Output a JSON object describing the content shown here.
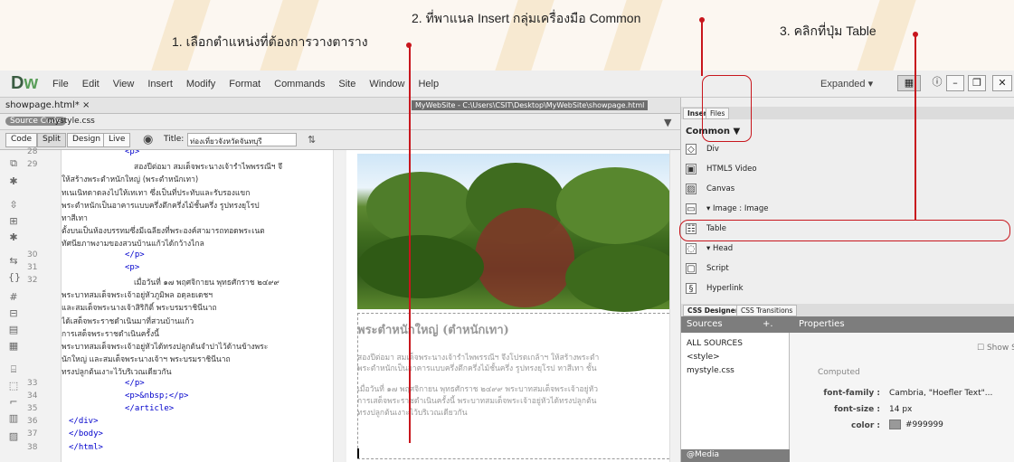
{
  "callouts": {
    "step1": "1. เลือกตำแหน่งที่ต้องการวางตาราง",
    "step2": "2. ที่พาแนล Insert กลุ่มเครื่องมือ Common",
    "step3": "3. คลิกที่ปุ่ม Table"
  },
  "app": {
    "logo_d": "D",
    "logo_w": "w",
    "menu": [
      "File",
      "Edit",
      "View",
      "Insert",
      "Modify",
      "Format",
      "Commands",
      "Site",
      "Window",
      "Help"
    ],
    "workspace": "Expanded",
    "workspace_arrow": "▾"
  },
  "document": {
    "tab": "showpage.html*",
    "tab_close": "×",
    "path": "MyWebSite - C:\\Users\\CSIT\\Desktop\\MyWebSite\\showpage.html",
    "source_code": "Source Code",
    "css_file": "mystyle.css",
    "views": [
      "Code",
      "Split",
      "Design",
      "Live"
    ],
    "title_label": "Title:",
    "title_value": "ท่องเที่ยวจังหวัดจันทบุรี"
  },
  "code_lines": [
    {
      "n": "28",
      "t": "<p>",
      "kind": "tag"
    },
    {
      "n": "29",
      "t": "สองปีต่อมา สมเด็จพระนางเจ้ารำไพพรรณีฯ จึ",
      "kind": "th"
    },
    {
      "n": "",
      "t": "ให้สร้างพระตำหนักใหญ่ (พระตำหนักเทา)",
      "kind": "th"
    },
    {
      "n": "",
      "t": "ทเนเนิทดาดลงไปให้เทเทา ซึ่งเป็นที่ประทับและรับรองแขก",
      "kind": "th"
    },
    {
      "n": "",
      "t": "พระตำหนักเป็นอาคารแบบครึ่งตึกครึ่งไม้ชั้นครึ่ง รูปทรงยุโรป",
      "kind": "th"
    },
    {
      "n": "",
      "t": "ทาสีเทา",
      "kind": "th"
    },
    {
      "n": "",
      "t": "ตั้งบนเป็นห้องบรรทมซึ่งมีเฉลียงที่พระองค์สามารถทอดพระเนต",
      "kind": "th"
    },
    {
      "n": "",
      "t": "ทัศนียภาพงามของสวนบ้านแก้วได้กว้างไกล",
      "kind": "th"
    },
    {
      "n": "30",
      "t": "</p>",
      "kind": "tag"
    },
    {
      "n": "31",
      "t": "<p>",
      "kind": "tag"
    },
    {
      "n": "32",
      "t": "เมื่อวันที่ ๑๗ พฤศจิกายน พุทธศักราช ๒๔๙๙",
      "kind": "th"
    },
    {
      "n": "",
      "t": "พระบาทสมเด็จพระเจ้าอยู่หัวภูมิพล อดุลยเดชฯ",
      "kind": "th"
    },
    {
      "n": "",
      "t": "และสมเด็จพระนางเจ้าสิริกิติ์ พระบรมราชินีนาถ",
      "kind": "th"
    },
    {
      "n": "",
      "t": "ได้เสด็จพระราชดำเนินมาที่สวนบ้านแก้ว",
      "kind": "th"
    },
    {
      "n": "",
      "t": "การเสด็จพระราชดำเนินครั้งนี้",
      "kind": "th"
    },
    {
      "n": "",
      "t": "พระบาทสมเด็จพระเจ้าอยู่หัวได้ทรงปลูกต้นจำปาไว้ด้านข้างพระ",
      "kind": "th"
    },
    {
      "n": "",
      "t": "นักใหญ่ และสมเด็จพระนางเจ้าฯ พระบรมราชินีนาถ",
      "kind": "th"
    },
    {
      "n": "",
      "t": "ทรงปลูกต้นเงาะไว้บริเวณเดียวกัน",
      "kind": "th"
    },
    {
      "n": "33",
      "t": "</p>",
      "kind": "tag"
    },
    {
      "n": "34",
      "t": "<p>&nbsp;</p>",
      "kind": "tag"
    },
    {
      "n": "35",
      "t": "</article>",
      "kind": "tag"
    },
    {
      "n": "36",
      "t": "</div>",
      "kind": "tag"
    },
    {
      "n": "37",
      "t": "</body>",
      "kind": "tag"
    },
    {
      "n": "38",
      "t": "</html>",
      "kind": "tag"
    }
  ],
  "design": {
    "heading": "พระตำหนักใหญ่ (ตำหนักเทา)",
    "para1_line1": "สองปีต่อมา สมเด็จพระนางเจ้ารำไพพรรณีฯ จึงโปรดเกล้าฯ ให้สร้างพระตำ",
    "para1_line2": "พระตำหนักเป็นอาคารแบบครึ่งตึกครึ่งไม้ชั้นครึ่ง รูปทรงยุโรป ทาสีเทา ชั้น",
    "para2_line1": "เมื่อวันที่ ๑๗ พฤศจิกายน พุทธศักราช ๒๔๙๙ พระบาทสมเด็จพระเจ้าอยู่หัว",
    "para2_line2": "การเสด็จพระราชดำเนินครั้งนี้ พระบาทสมเด็จพระเจ้าอยู่หัวได้ทรงปลูกต้น",
    "para2_line3": "ทรงปลูกต้นเงาะไว้บริเวณเดียวกัน"
  },
  "insert_panel": {
    "tabs": [
      "Insert",
      "Files"
    ],
    "category": "Common",
    "category_arrow": "▼",
    "items": [
      {
        "label": "Div",
        "icon": "div-icon"
      },
      {
        "label": "HTML5 Video",
        "icon": "video-icon"
      },
      {
        "label": "Canvas",
        "icon": "canvas-icon"
      },
      {
        "label": "▾ Image : Image",
        "icon": "image-icon"
      },
      {
        "label": "Table",
        "icon": "table-icon"
      },
      {
        "label": "▾ Head",
        "icon": "head-icon"
      },
      {
        "label": "Script",
        "icon": "script-icon"
      },
      {
        "label": "Hyperlink",
        "icon": "link-icon"
      }
    ]
  },
  "css_panel": {
    "tabs": [
      "CSS Designer",
      "CSS Transitions"
    ],
    "sources_title": "Sources",
    "sources_add": "+.",
    "sources": [
      "ALL SOURCES",
      "<style>",
      "mystyle.css"
    ],
    "media": "@Media",
    "properties_title": "Properties",
    "show_set": "Show S",
    "computed": "Computed",
    "props": [
      {
        "key": "font-family :",
        "value": "Cambria, \"Hoefler Text\"..."
      },
      {
        "key": "font-size :",
        "value": "14 px"
      },
      {
        "key": "color :",
        "value": "#999999"
      }
    ]
  },
  "colors": {
    "accent_red": "#c8161d",
    "text_color_swatch": "#999999"
  }
}
